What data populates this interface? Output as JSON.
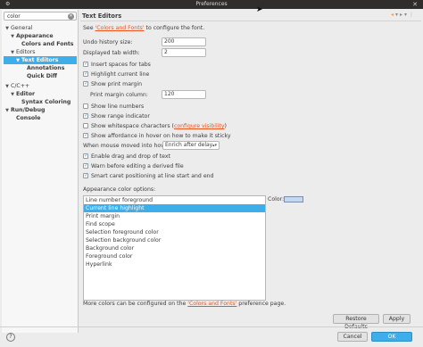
{
  "window": {
    "title": "Preferences"
  },
  "sidebar": {
    "filter_value": "color",
    "items": [
      {
        "label": "General",
        "twisty": "▼"
      },
      {
        "label": "Appearance",
        "twisty": "▼"
      },
      {
        "label": "Colors and Fonts",
        "twisty": ""
      },
      {
        "label": "Editors",
        "twisty": "▼"
      },
      {
        "label": "Text Editors",
        "twisty": "▼"
      },
      {
        "label": "Annotations",
        "twisty": ""
      },
      {
        "label": "Quick Diff",
        "twisty": ""
      },
      {
        "label": "C/C++",
        "twisty": "▼"
      },
      {
        "label": "Editor",
        "twisty": "▼"
      },
      {
        "label": "Syntax Coloring",
        "twisty": ""
      },
      {
        "label": "Run/Debug",
        "twisty": "▼"
      },
      {
        "label": "Console",
        "twisty": ""
      }
    ]
  },
  "page": {
    "title": "Text Editors",
    "intro_prefix": "See ",
    "intro_link": "'Colors and Fonts'",
    "intro_suffix": " to configure the font.",
    "undo_label": "Undo history size:",
    "undo_value": "200",
    "tab_label": "Displayed tab width:",
    "tab_value": "2",
    "cb_insert_spaces": "Insert spaces for tabs",
    "cb_highlight_line": "Highlight current line",
    "cb_print_margin": "Show print margin",
    "print_margin_label": "Print margin column:",
    "print_margin_value": "120",
    "cb_line_numbers": "Show line numbers",
    "cb_range_indicator": "Show range indicator",
    "cb_whitespace_prefix": "Show whitespace characters (",
    "cb_whitespace_link": "configure visibility",
    "cb_whitespace_suffix": ")",
    "cb_affordance": "Show affordance in hover on how to make it sticky",
    "hover_label": "When mouse moved into hover:",
    "hover_value": "Enrich after delay",
    "cb_drag_drop": "Enable drag and drop of text",
    "cb_warn_derived": "Warn before editing a derived file",
    "cb_smart_caret": "Smart caret positioning at line start and end",
    "appearance_label": "Appearance color options:",
    "color_label": "Color:",
    "color_options": [
      "Line number foreground",
      "Current line highlight",
      "Print margin",
      "Find scope",
      "Selection foreground color",
      "Selection background color",
      "Background color",
      "Foreground color",
      "Hyperlink"
    ],
    "selected_color_option": 1,
    "swatch_color": "#c5d8ef",
    "footer_prefix": "More colors can be configured on the ",
    "footer_link": "'Colors and Fonts'",
    "footer_suffix": " preference page.",
    "restore_defaults": "Restore Defaults",
    "apply": "Apply"
  },
  "dialog": {
    "cancel": "Cancel",
    "ok": "OK",
    "help": "?"
  },
  "colors": {
    "accent": "#3daee9",
    "link": "#e95420",
    "titlebar": "#2f2e2c"
  }
}
